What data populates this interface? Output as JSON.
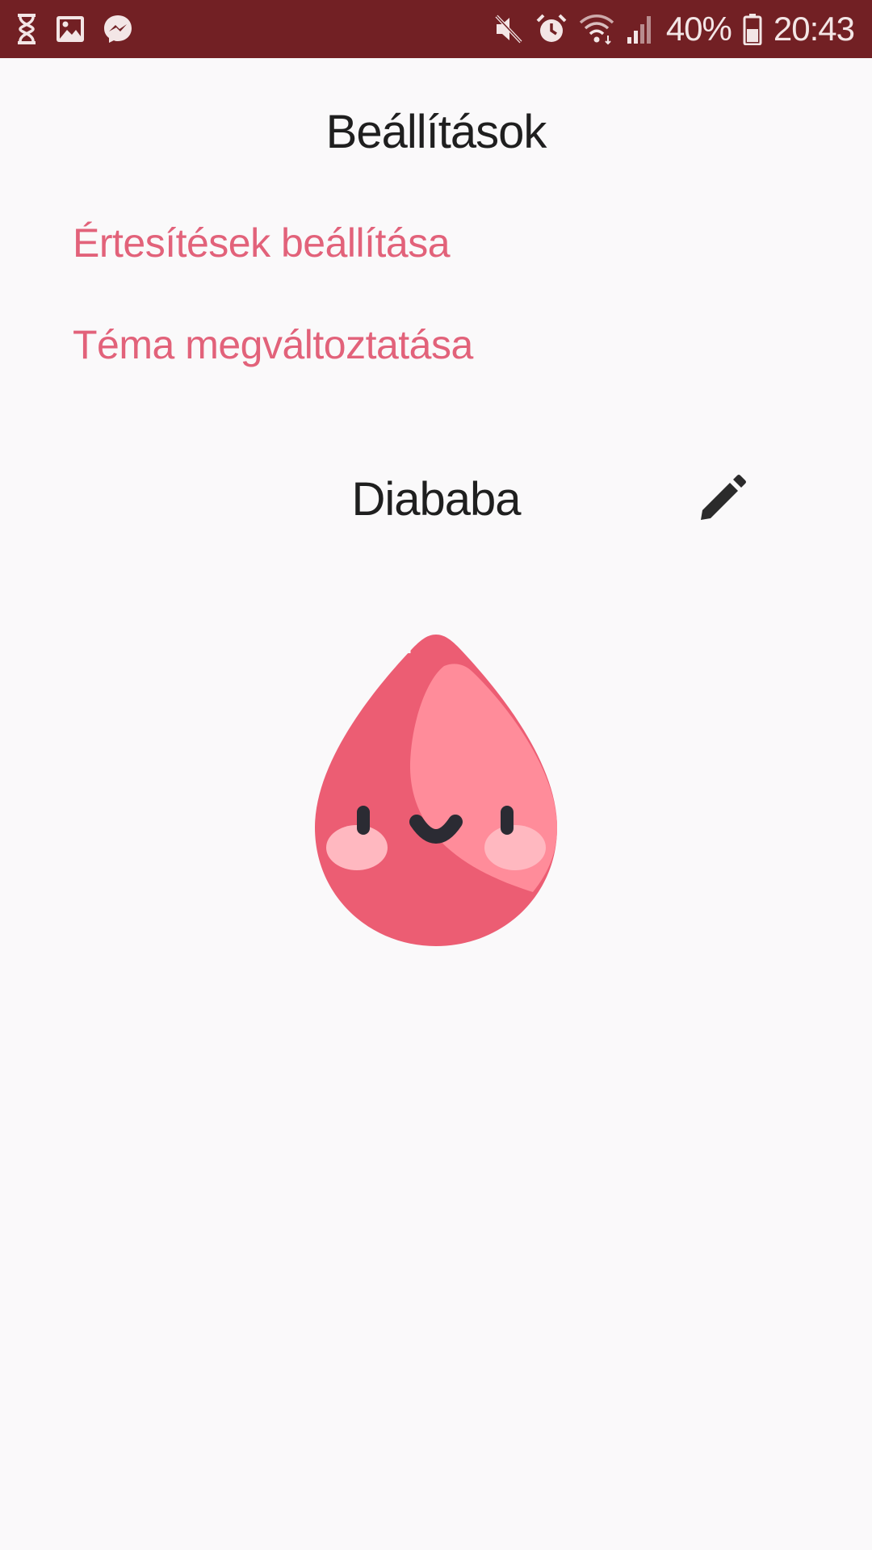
{
  "status_bar": {
    "left_icons": [
      "hourglass-icon",
      "gallery-icon",
      "messenger-icon"
    ],
    "right_icons": [
      "mute-icon",
      "alarm-icon",
      "wifi-icon",
      "signal-icon",
      "battery-icon"
    ],
    "battery_percent": "40%",
    "time": "20:43",
    "background_color": "#722024"
  },
  "page": {
    "title": "Beállítások"
  },
  "menu": {
    "notifications_label": "Értesítések beállítása",
    "theme_label": "Téma megváltoztatása"
  },
  "profile": {
    "name": "Diababa",
    "edit_icon": "pencil-icon",
    "mascot_icon": "blood-drop-mascot-icon"
  },
  "colors": {
    "accent": "#e2627a",
    "text": "#1f1f1f",
    "background": "#faf9fa"
  }
}
